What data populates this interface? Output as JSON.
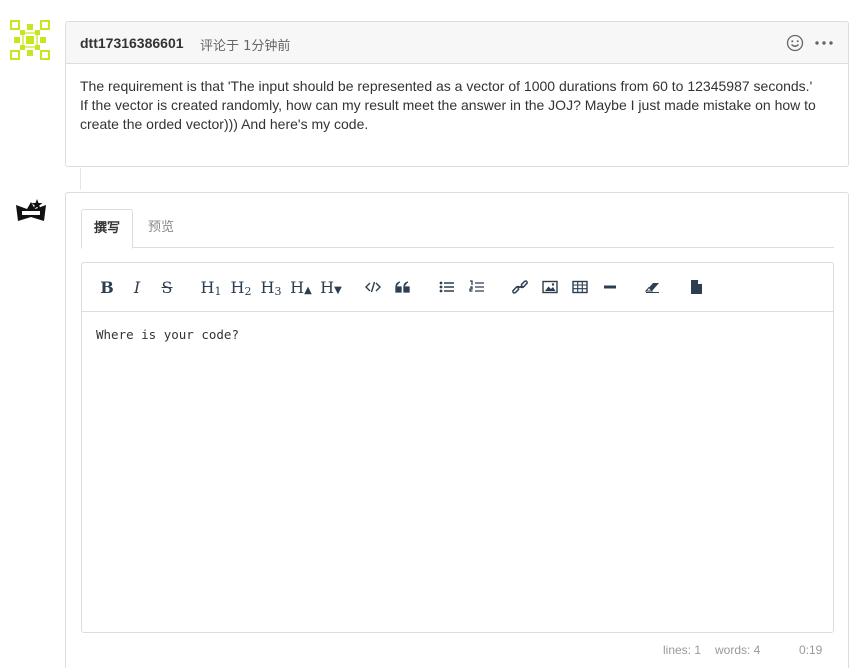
{
  "comment": {
    "author": "dtt17316386601",
    "meta": "评论于 1分钟前",
    "body_lines": [
      "The requirement is that 'The input should be represented as a vector of 1000 durations from 60 to 12345987 seconds.'",
      "If the vector is created randomly, how can my result meet the answer in the JOJ? Maybe I just made mistake on how to create the orded vector))) And here's my code."
    ],
    "icons": {
      "emoji": "smile-icon",
      "more": "more-icon"
    }
  },
  "reply": {
    "tabs": [
      {
        "label": "撰写",
        "active": true
      },
      {
        "label": "预览",
        "active": false
      }
    ],
    "toolbar": [
      {
        "name": "bold",
        "glyph": "B"
      },
      {
        "name": "italic",
        "glyph": "I"
      },
      {
        "name": "strikethrough",
        "glyph": "S"
      },
      {
        "name": "heading-1",
        "glyph": "H1"
      },
      {
        "name": "heading-2",
        "glyph": "H2"
      },
      {
        "name": "heading-3",
        "glyph": "H3"
      },
      {
        "name": "heading-bigger",
        "glyph": "H▲"
      },
      {
        "name": "heading-smaller",
        "glyph": "H▼"
      },
      {
        "name": "code",
        "glyph": "code-icon"
      },
      {
        "name": "quote",
        "glyph": "quote-icon"
      },
      {
        "name": "unordered-list",
        "glyph": "list-ul-icon"
      },
      {
        "name": "ordered-list",
        "glyph": "list-ol-icon"
      },
      {
        "name": "link",
        "glyph": "link-icon"
      },
      {
        "name": "image",
        "glyph": "image-icon"
      },
      {
        "name": "table",
        "glyph": "table-icon"
      },
      {
        "name": "horizontal-rule",
        "glyph": "minus-icon"
      },
      {
        "name": "clean-block",
        "glyph": "eraser-icon"
      },
      {
        "name": "guide",
        "glyph": "file-icon"
      }
    ],
    "content": "Where is your code?",
    "status": {
      "lines": "lines: 1",
      "words": "words: 4",
      "cursor": "0:19"
    }
  },
  "colors": {
    "avatar_green": "#c8e620",
    "border": "#dddddd",
    "icon": "#2c3e50"
  }
}
